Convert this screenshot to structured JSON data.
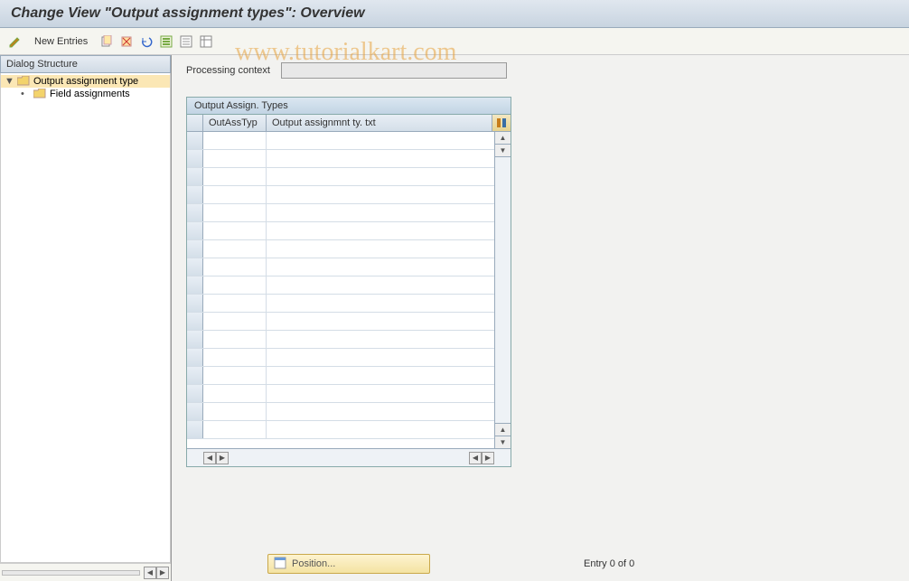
{
  "title": "Change View \"Output assignment types\": Overview",
  "watermark": "www.tutorialkart.com",
  "toolbar": {
    "new_entries_label": "New Entries"
  },
  "sidebar": {
    "header": "Dialog Structure",
    "items": [
      {
        "label": "Output assignment type",
        "selected": true,
        "open": true,
        "level": 0
      },
      {
        "label": "Field assignments",
        "selected": false,
        "open": false,
        "level": 1
      }
    ]
  },
  "main": {
    "field_label": "Processing context",
    "field_value": "",
    "grid": {
      "title": "Output Assign. Types",
      "columns": [
        "OutAssTyp",
        "Output assignmnt ty. txt"
      ],
      "row_count": 17
    },
    "position_button": "Position...",
    "entry_status": "Entry 0 of 0"
  }
}
